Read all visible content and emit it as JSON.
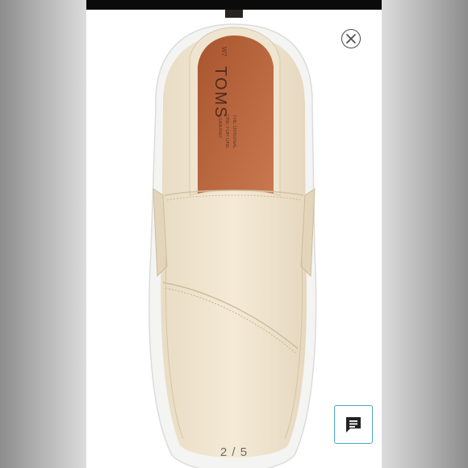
{
  "viewer": {
    "close_label": "Close",
    "close_icon": "close-circle-icon",
    "chat_label": "Comments",
    "chat_icon": "chat-bubble-icon",
    "pager": "2 / 5"
  },
  "product_photo": {
    "brand_text": "TOMS",
    "size_text": "W7",
    "insole_tagline": "THE ORIGINAL ONE FOR ONE COMPANY",
    "colors": {
      "canvas": "#f1e6d1",
      "insole": "#b8643e",
      "sole": "#f4f4f2",
      "accent": "#4aa7c6"
    }
  }
}
